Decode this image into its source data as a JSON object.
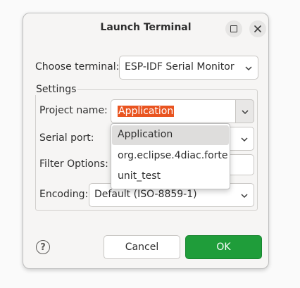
{
  "window": {
    "title": "Launch Terminal"
  },
  "choose_terminal": {
    "label": "Choose terminal:",
    "value": "ESP-IDF Serial Monitor"
  },
  "settings": {
    "group_title": "Settings",
    "project_name": {
      "label": "Project name:",
      "value": "Application"
    },
    "serial_port": {
      "label": "Serial port:",
      "value": ""
    },
    "filter_options": {
      "label": "Filter Options:",
      "value": ""
    },
    "encoding": {
      "label": "Encoding:",
      "value": "Default (ISO-8859-1)"
    }
  },
  "project_dropdown": {
    "items": [
      {
        "label": "Application",
        "selected": true
      },
      {
        "label": "org.eclipse.4diac.forte",
        "selected": false
      },
      {
        "label": "unit_test",
        "selected": false
      }
    ]
  },
  "buttons": {
    "cancel": "Cancel",
    "ok": "OK",
    "help_glyph": "?"
  },
  "colors": {
    "selection_highlight": "#e95420",
    "ok_button": "#1f9d3a",
    "dropdown_selected": "#dedddc"
  },
  "icons": {
    "maximize": "maximize-icon",
    "close": "close-icon",
    "chevron": "chevron-down-icon",
    "help": "help-icon"
  }
}
